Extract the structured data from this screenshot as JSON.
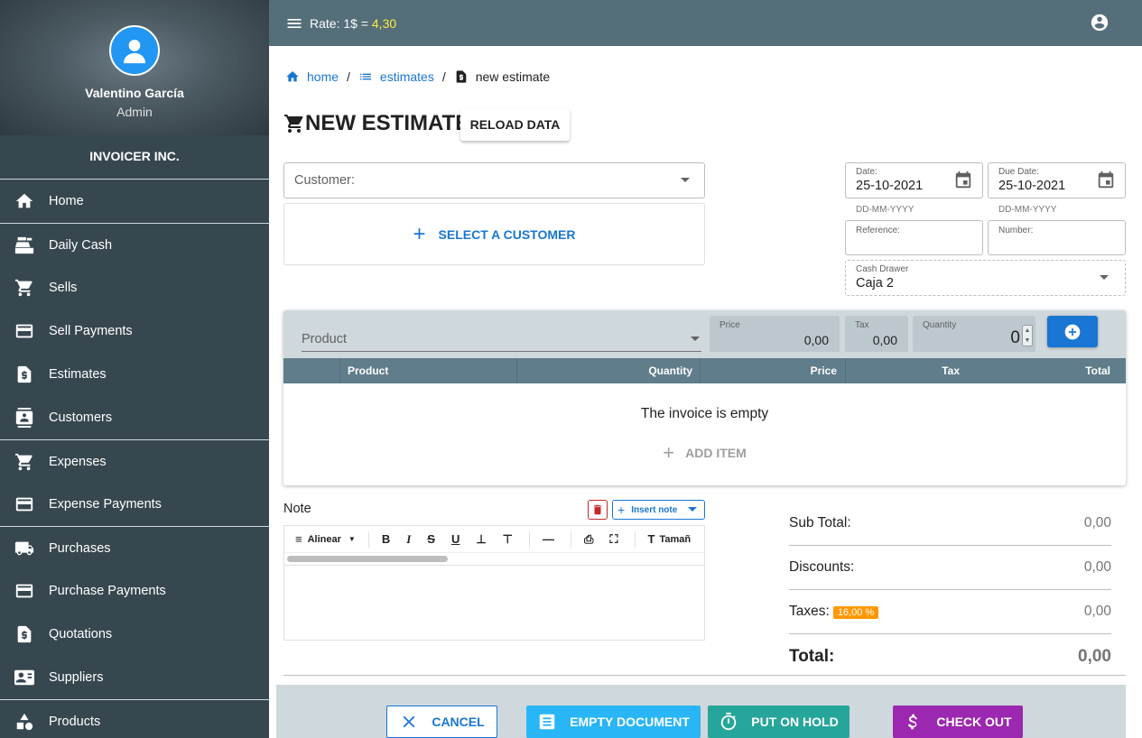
{
  "topbar": {
    "rate_label": "Rate: 1$ = ",
    "rate_value": "4,30"
  },
  "profile": {
    "name": "Valentino García",
    "role": "Admin"
  },
  "company": "INVOICER INC.",
  "sidebar": {
    "items": [
      {
        "label": "Home",
        "icon": "home-icon"
      },
      {
        "label": "Daily Cash",
        "icon": "cash-register-icon"
      },
      {
        "label": "Sells",
        "icon": "cart-icon"
      },
      {
        "label": "Sell Payments",
        "icon": "credit-card-icon"
      },
      {
        "label": "Estimates",
        "icon": "document-dollar-icon"
      },
      {
        "label": "Customers",
        "icon": "contact-icon"
      },
      {
        "label": "Expenses",
        "icon": "cart-icon"
      },
      {
        "label": "Expense Payments",
        "icon": "credit-card-icon"
      },
      {
        "label": "Purchases",
        "icon": "truck-icon"
      },
      {
        "label": "Purchase Payments",
        "icon": "credit-card-icon"
      },
      {
        "label": "Quotations",
        "icon": "document-dollar-icon"
      },
      {
        "label": "Suppliers",
        "icon": "contacts-card-icon"
      },
      {
        "label": "Products",
        "icon": "shapes-icon"
      }
    ]
  },
  "breadcrumb": {
    "home": "home",
    "estimates": "estimates",
    "current": "new estimate"
  },
  "page": {
    "title": "NEW ESTIMATE",
    "reload_label": "RELOAD DATA"
  },
  "customer": {
    "placeholder": "Customer:",
    "select_label": "SELECT A CUSTOMER"
  },
  "dates": {
    "date_label": "Date:",
    "date_value": "25-10-2021",
    "date_hint": "DD-MM-YYYY",
    "due_label": "Due Date:",
    "due_value": "25-10-2021",
    "due_hint": "DD-MM-YYYY"
  },
  "reference": {
    "label": "Reference:"
  },
  "number": {
    "label": "Number:"
  },
  "cash_drawer": {
    "label": "Cash Drawer",
    "value": "Caja 2"
  },
  "item_entry": {
    "product_placeholder": "Product",
    "price_label": "Price",
    "price_value": "0,00",
    "tax_label": "Tax",
    "tax_value": "0,00",
    "quantity_label": "Quantity",
    "quantity_value": "0"
  },
  "table": {
    "columns": [
      "Product",
      "Quantity",
      "Price",
      "Tax",
      "Total"
    ],
    "empty_message": "The invoice is empty",
    "add_item_label": "ADD ITEM"
  },
  "note": {
    "label": "Note",
    "insert_label": "Insert note",
    "toolbar": {
      "align_label": "Alinear",
      "size_label": "Tamañ"
    }
  },
  "totals": {
    "subtotal_label": "Sub Total:",
    "subtotal_value": "0,00",
    "discounts_label": "Discounts:",
    "discounts_value": "0,00",
    "taxes_label": "Taxes:",
    "taxes_badge": "16,00 %",
    "taxes_value": "0,00",
    "total_label": "Total:",
    "total_value": "0,00"
  },
  "footer": {
    "cancel_label": "CANCEL",
    "empty_label": "EMPTY DOCUMENT",
    "hold_label": "PUT ON HOLD",
    "checkout_label": "CHECK OUT"
  },
  "colors": {
    "sidebar_bg": "#37474f",
    "topbar_bg": "#546e7a",
    "accent_blue": "#1976d2",
    "rate_highlight": "#ffeb3b",
    "tax_badge": "#ff9800",
    "empty_btn": "#29b6f6",
    "hold_btn": "#26a69a",
    "checkout_btn": "#9c27b0",
    "delete": "#c62828"
  }
}
